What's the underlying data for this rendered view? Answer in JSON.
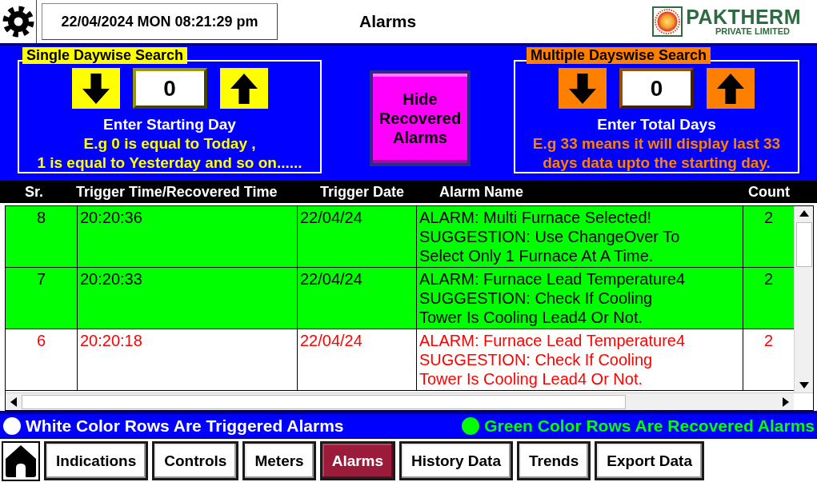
{
  "header": {
    "datetime": "22/04/2024 MON 08:21:29 pm",
    "title": "Alarms",
    "logo": {
      "name": "PAKTHERM",
      "subtitle": "PRIVATE LIMITED"
    }
  },
  "search_panel": {
    "searches": [
      {
        "title": "Single Daywise Search",
        "color": "#ffff00",
        "value": "0",
        "label": "Enter Starting Day",
        "hint": [
          "E.g 0 is equal to Today ,",
          "1 is equal to Yesterday and so on......"
        ]
      },
      {
        "title": "Multiple Dayswise Search",
        "color": "#ff8000",
        "value": "0",
        "label": "Enter Total Days",
        "hint": [
          "E.g 33 means it will display last 33",
          "days data upto the starting day."
        ]
      }
    ],
    "hide_button": {
      "label": "Hide Recovered Alarms"
    }
  },
  "table": {
    "columns": [
      "Sr.",
      "Trigger Time/Recovered Time",
      "Trigger Date",
      "Alarm Name",
      "Count"
    ],
    "rows": [
      {
        "sr": "8",
        "trigger_time": "20:20:36",
        "trigger_date": "22/04/24",
        "alarm_name": [
          "ALARM: Multi Furnace Selected!",
          "SUGGESTION: Use ChangeOver To",
          "Select Only 1 Furnace At A Time."
        ],
        "count": "2",
        "recovered": true
      },
      {
        "sr": "7",
        "trigger_time": "20:20:33",
        "trigger_date": "22/04/24",
        "alarm_name": [
          "ALARM: Furnace Lead Temperature4",
          "SUGGESTION: Check If Cooling",
          "Tower Is Cooling Lead4 Or Not."
        ],
        "count": "2",
        "recovered": true
      },
      {
        "sr": "6",
        "trigger_time": "20:20:18",
        "trigger_date": "22/04/24",
        "alarm_name": [
          "ALARM: Furnace Lead Temperature4",
          "SUGGESTION: Check If Cooling",
          "Tower Is Cooling Lead4 Or Not."
        ],
        "count": "2",
        "recovered": false
      }
    ]
  },
  "legend": [
    {
      "text": "White Color Rows Are Triggered Alarms",
      "color": "#ffffff"
    },
    {
      "text": "Green Color Rows Are Recovered Alarms",
      "color": "#00ff00"
    }
  ],
  "nav": {
    "items": [
      {
        "label": "Indications",
        "selected": false
      },
      {
        "label": "Controls",
        "selected": false
      },
      {
        "label": "Meters",
        "selected": false
      },
      {
        "label": "Alarms",
        "selected": true
      },
      {
        "label": "History Data",
        "selected": false
      },
      {
        "label": "Trends",
        "selected": false
      },
      {
        "label": "Export Data",
        "selected": false
      }
    ]
  }
}
